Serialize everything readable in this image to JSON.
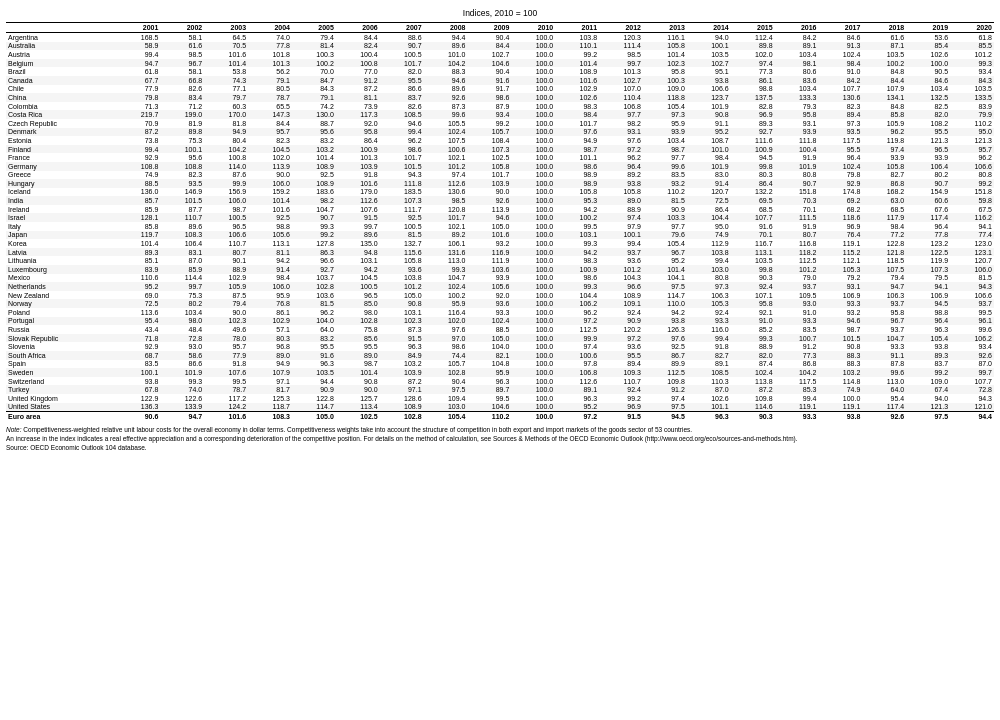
{
  "title": "Indices, 2010 = 100",
  "columns": [
    "",
    "2001",
    "2002",
    "2003",
    "2004",
    "2005",
    "2006",
    "2007",
    "2008",
    "2009",
    "2010",
    "2011",
    "2012",
    "2013",
    "2014",
    "2015",
    "2016",
    "2017",
    "2018",
    "2019",
    "2020"
  ],
  "rows": [
    [
      "Argentina",
      "168.5",
      "58.1",
      "64.5",
      "74.0",
      "79.4",
      "84.4",
      "88.6",
      "94.4",
      "90.4",
      "100.0",
      "103.8",
      "120.3",
      "116.1",
      "94.0",
      "112.4",
      "84.2",
      "84.6",
      "61.6",
      "53.6",
      "61.8"
    ],
    [
      "Australia",
      "58.9",
      "61.6",
      "70.5",
      "77.8",
      "81.4",
      "82.4",
      "90.7",
      "89.6",
      "84.4",
      "100.0",
      "110.1",
      "111.4",
      "105.8",
      "100.1",
      "89.8",
      "89.1",
      "91.3",
      "87.1",
      "85.4",
      "85.5"
    ],
    [
      "Austria",
      "99.4",
      "98.5",
      "101.6",
      "101.8",
      "100.3",
      "100.4",
      "100.5",
      "101.0",
      "102.7",
      "100.0",
      "99.2",
      "98.5",
      "101.4",
      "103.5",
      "102.0",
      "103.4",
      "102.4",
      "103.5",
      "102.6",
      "101.2"
    ],
    [
      "Belgium",
      "94.7",
      "96.7",
      "101.4",
      "101.3",
      "100.2",
      "100.8",
      "101.7",
      "104.2",
      "104.6",
      "100.0",
      "101.4",
      "99.7",
      "102.3",
      "102.7",
      "97.4",
      "98.1",
      "98.4",
      "100.2",
      "100.0",
      "99.3"
    ],
    [
      "Brazil",
      "61.8",
      "58.1",
      "53.8",
      "56.2",
      "70.0",
      "77.0",
      "82.0",
      "88.3",
      "90.4",
      "100.0",
      "108.9",
      "101.3",
      "95.8",
      "95.1",
      "77.3",
      "80.6",
      "91.0",
      "84.8",
      "90.5",
      "93.4"
    ],
    [
      "Canada",
      "67.7",
      "66.8",
      "74.3",
      "79.1",
      "84.7",
      "91.2",
      "95.5",
      "94.6",
      "91.6",
      "100.0",
      "101.6",
      "102.7",
      "100.3",
      "93.8",
      "86.1",
      "83.6",
      "84.2",
      "84.4",
      "84.6",
      "84.3"
    ],
    [
      "Chile",
      "77.9",
      "82.6",
      "77.1",
      "80.5",
      "84.3",
      "87.2",
      "86.6",
      "89.6",
      "91.7",
      "100.0",
      "102.9",
      "107.0",
      "109.0",
      "106.6",
      "98.8",
      "103.4",
      "107.7",
      "107.9",
      "103.4",
      "103.5"
    ],
    [
      "China",
      "79.8",
      "83.4",
      "79.7",
      "78.7",
      "79.1",
      "81.1",
      "83.7",
      "92.6",
      "98.6",
      "100.0",
      "102.6",
      "110.4",
      "118.8",
      "123.7",
      "137.5",
      "133.3",
      "130.6",
      "134.1",
      "132.5",
      "133.5"
    ],
    [
      "Colombia",
      "71.3",
      "71.2",
      "60.3",
      "65.5",
      "74.2",
      "73.9",
      "82.6",
      "87.3",
      "87.9",
      "100.0",
      "98.3",
      "106.8",
      "105.4",
      "101.9",
      "82.8",
      "79.3",
      "82.3",
      "84.8",
      "82.5",
      "83.9"
    ],
    [
      "Costa Rica",
      "219.7",
      "199.0",
      "170.0",
      "147.3",
      "130.0",
      "117.3",
      "108.5",
      "99.6",
      "93.4",
      "100.0",
      "98.4",
      "97.7",
      "97.3",
      "90.8",
      "96.9",
      "95.8",
      "89.4",
      "85.8",
      "82.0",
      "79.9"
    ],
    [
      "Czech Republic",
      "70.9",
      "81.9",
      "81.8",
      "84.4",
      "88.7",
      "92.0",
      "94.6",
      "105.5",
      "99.2",
      "100.0",
      "101.7",
      "98.2",
      "95.9",
      "91.1",
      "89.3",
      "93.1",
      "97.3",
      "105.9",
      "108.2",
      "110.2"
    ],
    [
      "Denmark",
      "87.2",
      "89.8",
      "94.9",
      "95.7",
      "95.6",
      "95.8",
      "99.4",
      "102.4",
      "105.7",
      "100.0",
      "97.6",
      "93.1",
      "93.9",
      "95.2",
      "92.7",
      "93.9",
      "93.5",
      "96.2",
      "95.5",
      "95.0"
    ],
    [
      "Estonia",
      "73.8",
      "75.3",
      "80.4",
      "82.3",
      "83.2",
      "86.4",
      "96.2",
      "107.5",
      "108.4",
      "100.0",
      "94.9",
      "97.6",
      "103.4",
      "108.7",
      "111.6",
      "111.8",
      "117.5",
      "119.8",
      "121.3",
      "121.3"
    ],
    [
      "Finland",
      "99.4",
      "100.1",
      "104.2",
      "104.5",
      "103.2",
      "100.9",
      "98.6",
      "100.6",
      "107.3",
      "100.0",
      "98.7",
      "97.2",
      "98.7",
      "101.0",
      "100.9",
      "100.4",
      "95.5",
      "97.4",
      "96.5",
      "95.7"
    ],
    [
      "France",
      "92.9",
      "95.6",
      "100.8",
      "102.0",
      "101.4",
      "101.3",
      "101.7",
      "102.1",
      "102.5",
      "100.0",
      "101.1",
      "96.2",
      "97.7",
      "98.4",
      "94.5",
      "91.9",
      "96.4",
      "93.9",
      "93.9",
      "96.2"
    ],
    [
      "Germany",
      "108.8",
      "108.8",
      "114.0",
      "113.9",
      "108.9",
      "103.9",
      "101.5",
      "101.2",
      "105.8",
      "100.0",
      "98.6",
      "96.4",
      "99.6",
      "101.9",
      "99.8",
      "101.9",
      "102.4",
      "105.8",
      "106.4",
      "106.6"
    ],
    [
      "Greece",
      "74.9",
      "82.3",
      "87.6",
      "90.0",
      "92.5",
      "91.8",
      "94.3",
      "97.4",
      "101.7",
      "100.0",
      "98.9",
      "89.2",
      "83.5",
      "83.0",
      "80.3",
      "80.8",
      "79.8",
      "82.7",
      "80.2",
      "80.8"
    ],
    [
      "Hungary",
      "88.5",
      "93.5",
      "99.9",
      "106.0",
      "108.9",
      "101.6",
      "111.8",
      "112.6",
      "103.9",
      "100.0",
      "98.9",
      "93.8",
      "93.2",
      "91.4",
      "86.4",
      "90.7",
      "92.9",
      "86.8",
      "90.7",
      "99.2"
    ],
    [
      "Iceland",
      "136.0",
      "146.9",
      "156.9",
      "159.2",
      "183.6",
      "179.0",
      "183.5",
      "130.6",
      "90.0",
      "100.0",
      "105.8",
      "105.8",
      "110.2",
      "120.7",
      "132.2",
      "151.8",
      "174.8",
      "168.2",
      "154.9",
      "151.8"
    ],
    [
      "India",
      "85.7",
      "101.5",
      "106.0",
      "101.4",
      "98.2",
      "112.6",
      "107.3",
      "98.5",
      "92.6",
      "100.0",
      "95.3",
      "89.0",
      "81.5",
      "72.5",
      "69.5",
      "70.3",
      "69.2",
      "63.0",
      "60.6",
      "59.8"
    ],
    [
      "Ireland",
      "85.9",
      "87.7",
      "98.7",
      "101.6",
      "104.7",
      "107.6",
      "111.7",
      "120.8",
      "113.9",
      "100.0",
      "94.2",
      "88.9",
      "90.9",
      "86.4",
      "68.5",
      "70.1",
      "68.2",
      "68.5",
      "67.6",
      "67.5"
    ],
    [
      "Israel",
      "128.1",
      "110.7",
      "100.5",
      "92.5",
      "90.7",
      "91.5",
      "92.5",
      "101.7",
      "94.6",
      "100.0",
      "100.2",
      "97.4",
      "103.3",
      "104.4",
      "107.7",
      "111.5",
      "118.6",
      "117.9",
      "117.4",
      "116.2"
    ],
    [
      "Italy",
      "85.8",
      "89.6",
      "96.5",
      "98.8",
      "99.3",
      "99.7",
      "100.5",
      "102.1",
      "105.0",
      "100.0",
      "99.5",
      "97.9",
      "97.7",
      "95.0",
      "91.6",
      "91.9",
      "96.9",
      "98.4",
      "96.4",
      "94.1"
    ],
    [
      "Japan",
      "119.7",
      "108.3",
      "106.6",
      "105.6",
      "99.2",
      "89.6",
      "81.5",
      "89.2",
      "101.6",
      "100.0",
      "103.1",
      "100.1",
      "79.6",
      "74.9",
      "70.1",
      "80.7",
      "76.4",
      "77.2",
      "77.8",
      "77.4"
    ],
    [
      "Korea",
      "101.4",
      "106.4",
      "110.7",
      "113.1",
      "127.8",
      "135.0",
      "132.7",
      "106.1",
      "93.2",
      "100.0",
      "99.3",
      "99.4",
      "105.4",
      "112.9",
      "116.7",
      "116.8",
      "119.1",
      "122.8",
      "123.2",
      "123.0"
    ],
    [
      "Latvia",
      "89.3",
      "83.1",
      "80.7",
      "81.1",
      "86.3",
      "94.8",
      "115.6",
      "131.6",
      "116.9",
      "100.0",
      "94.2",
      "93.7",
      "96.7",
      "103.8",
      "113.1",
      "118.2",
      "115.2",
      "121.8",
      "122.5",
      "123.1"
    ],
    [
      "Lithuania",
      "85.1",
      "87.0",
      "90.1",
      "94.2",
      "96.6",
      "103.1",
      "105.8",
      "113.0",
      "111.9",
      "100.0",
      "98.3",
      "93.6",
      "95.2",
      "99.4",
      "103.5",
      "112.5",
      "112.1",
      "118.5",
      "119.9",
      "120.7"
    ],
    [
      "Luxembourg",
      "83.9",
      "85.9",
      "88.9",
      "91.4",
      "92.7",
      "94.2",
      "93.6",
      "99.3",
      "103.6",
      "100.0",
      "100.9",
      "101.2",
      "101.4",
      "103.0",
      "99.8",
      "101.2",
      "105.3",
      "107.5",
      "107.3",
      "106.0"
    ],
    [
      "Mexico",
      "110.6",
      "114.4",
      "102.9",
      "98.4",
      "103.7",
      "104.5",
      "103.8",
      "104.7",
      "93.9",
      "100.0",
      "98.6",
      "104.3",
      "104.1",
      "80.8",
      "90.3",
      "79.0",
      "79.2",
      "79.4",
      "79.5",
      "81.5"
    ],
    [
      "Netherlands",
      "95.2",
      "99.7",
      "105.9",
      "106.0",
      "102.8",
      "100.5",
      "101.2",
      "102.4",
      "105.6",
      "100.0",
      "99.3",
      "96.6",
      "97.5",
      "97.3",
      "92.4",
      "93.7",
      "93.1",
      "94.7",
      "94.1",
      "94.3"
    ],
    [
      "New Zealand",
      "69.0",
      "75.3",
      "87.5",
      "95.9",
      "103.6",
      "96.5",
      "105.0",
      "100.2",
      "92.0",
      "100.0",
      "104.4",
      "108.9",
      "114.7",
      "106.3",
      "107.1",
      "109.5",
      "106.9",
      "106.3",
      "106.9",
      "106.6"
    ],
    [
      "Norway",
      "72.5",
      "80.2",
      "79.4",
      "76.8",
      "81.5",
      "85.0",
      "90.8",
      "95.9",
      "93.6",
      "100.0",
      "106.2",
      "109.1",
      "110.0",
      "105.3",
      "95.8",
      "93.0",
      "93.3",
      "93.7",
      "94.5",
      "93.7"
    ],
    [
      "Poland",
      "113.6",
      "103.4",
      "90.0",
      "86.1",
      "96.2",
      "98.0",
      "103.1",
      "116.4",
      "93.3",
      "100.0",
      "96.2",
      "92.4",
      "94.2",
      "92.4",
      "92.1",
      "91.0",
      "93.2",
      "95.8",
      "98.8",
      "99.5"
    ],
    [
      "Portugal",
      "95.4",
      "98.0",
      "102.3",
      "102.9",
      "104.0",
      "102.8",
      "102.3",
      "102.0",
      "102.4",
      "100.0",
      "97.2",
      "90.9",
      "93.8",
      "93.3",
      "91.0",
      "93.3",
      "94.6",
      "96.7",
      "96.4",
      "96.1"
    ],
    [
      "Russia",
      "43.4",
      "48.4",
      "49.6",
      "57.1",
      "64.0",
      "75.8",
      "87.3",
      "97.6",
      "88.5",
      "100.0",
      "112.5",
      "120.2",
      "126.3",
      "116.0",
      "85.2",
      "83.5",
      "98.7",
      "93.7",
      "96.3",
      "99.6"
    ],
    [
      "Slovak Republic",
      "71.8",
      "72.8",
      "78.0",
      "80.3",
      "83.2",
      "85.6",
      "91.5",
      "97.0",
      "105.0",
      "100.0",
      "99.9",
      "97.2",
      "97.6",
      "99.4",
      "99.3",
      "100.7",
      "101.5",
      "104.7",
      "105.4",
      "106.2"
    ],
    [
      "Slovenia",
      "92.9",
      "93.0",
      "95.7",
      "96.8",
      "95.5",
      "95.5",
      "96.3",
      "98.6",
      "104.0",
      "100.0",
      "97.4",
      "93.6",
      "92.5",
      "91.8",
      "88.9",
      "91.2",
      "90.8",
      "93.3",
      "93.8",
      "93.4"
    ],
    [
      "South Africa",
      "68.7",
      "58.6",
      "77.9",
      "89.0",
      "91.6",
      "89.0",
      "84.9",
      "74.4",
      "82.1",
      "100.0",
      "100.6",
      "95.5",
      "86.7",
      "82.7",
      "82.0",
      "77.3",
      "88.3",
      "91.1",
      "89.3",
      "92.6"
    ],
    [
      "Spain",
      "83.5",
      "86.6",
      "91.8",
      "94.9",
      "96.3",
      "98.7",
      "103.2",
      "105.7",
      "104.8",
      "100.0",
      "97.8",
      "89.4",
      "89.9",
      "89.1",
      "87.4",
      "86.8",
      "88.3",
      "87.8",
      "83.7",
      "87.0"
    ],
    [
      "Sweden",
      "100.1",
      "101.9",
      "107.6",
      "107.9",
      "103.5",
      "101.4",
      "103.9",
      "102.8",
      "95.9",
      "100.0",
      "106.8",
      "109.3",
      "112.5",
      "108.5",
      "102.4",
      "104.2",
      "103.2",
      "99.6",
      "99.2",
      "99.7"
    ],
    [
      "Switzerland",
      "93.8",
      "99.3",
      "99.5",
      "97.1",
      "94.4",
      "90.8",
      "87.2",
      "90.4",
      "96.3",
      "100.0",
      "112.6",
      "110.7",
      "109.8",
      "110.3",
      "113.8",
      "117.5",
      "114.8",
      "113.0",
      "109.0",
      "107.7"
    ],
    [
      "Turkey",
      "67.8",
      "74.0",
      "78.7",
      "81.7",
      "90.9",
      "90.0",
      "97.1",
      "97.5",
      "89.7",
      "100.0",
      "89.1",
      "92.4",
      "91.2",
      "87.0",
      "87.2",
      "85.3",
      "74.9",
      "64.0",
      "67.4",
      "72.8"
    ],
    [
      "United Kingdom",
      "122.9",
      "122.6",
      "117.2",
      "125.3",
      "122.8",
      "125.7",
      "128.6",
      "109.4",
      "99.5",
      "100.0",
      "96.3",
      "99.2",
      "97.4",
      "102.6",
      "109.8",
      "99.4",
      "100.0",
      "95.4",
      "94.0",
      "94.3"
    ],
    [
      "United States",
      "136.3",
      "133.9",
      "124.2",
      "118.7",
      "114.7",
      "113.4",
      "108.9",
      "103.0",
      "104.6",
      "100.0",
      "95.2",
      "96.9",
      "97.5",
      "101.1",
      "114.6",
      "119.1",
      "119.1",
      "117.4",
      "121.3",
      "121.0"
    ],
    [
      "Euro area",
      "90.6",
      "94.7",
      "101.6",
      "108.3",
      "105.0",
      "102.5",
      "102.8",
      "105.4",
      "110.2",
      "100.0",
      "97.2",
      "91.5",
      "94.5",
      "96.3",
      "90.3",
      "93.3",
      "93.8",
      "92.6",
      "97.5",
      "94.4"
    ]
  ],
  "footer": {
    "note_label": "Note:",
    "note_text": " Competitiveness-weighted relative unit labour costs for the overall economy in dollar terms. Competitiveness weights take into account the structure of competition in both export and import markets of the goods sector of 53 countries.",
    "note2": "An increase in the index indicates a real effective appreciation and a corresponding deterioration of the competitive position. For details on the method of calculation, see Sources & Methods of the OECD Economic Outlook",
    "link_text": "(http://www.oecd.org/eco/sources-and-methods.htm).",
    "source": "Source: OECD Economic Outlook 104 database."
  }
}
